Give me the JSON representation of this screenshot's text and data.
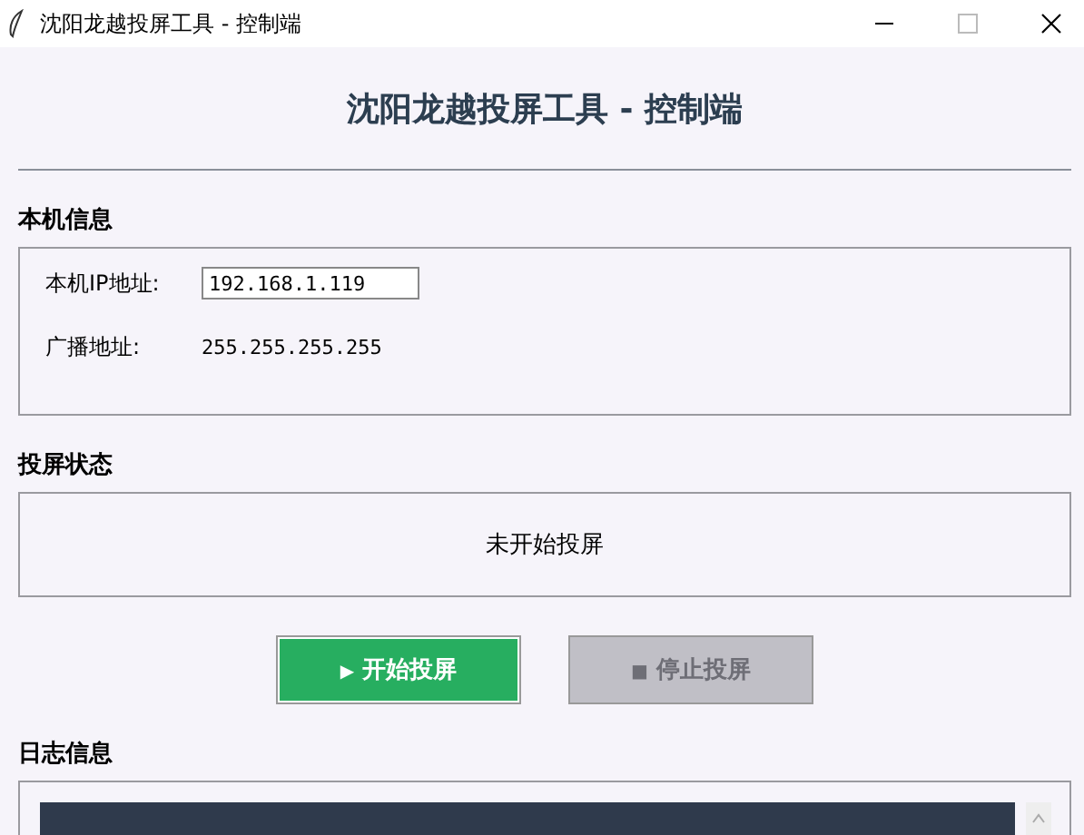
{
  "window": {
    "title": "沈阳龙越投屏工具 - 控制端"
  },
  "header": {
    "title": "沈阳龙越投屏工具 - 控制端"
  },
  "local_info": {
    "heading": "本机信息",
    "ip_label": "本机IP地址:",
    "ip_value": "192.168.1.119",
    "broadcast_label": "广播地址:",
    "broadcast_value": "255.255.255.255"
  },
  "status": {
    "heading": "投屏状态",
    "text": "未开始投屏"
  },
  "buttons": [
    {
      "icon": "▶",
      "label": "开始投屏",
      "disabled": false
    },
    {
      "icon": "■",
      "label": "停止投屏",
      "disabled": true
    }
  ],
  "log": {
    "heading": "日志信息"
  }
}
